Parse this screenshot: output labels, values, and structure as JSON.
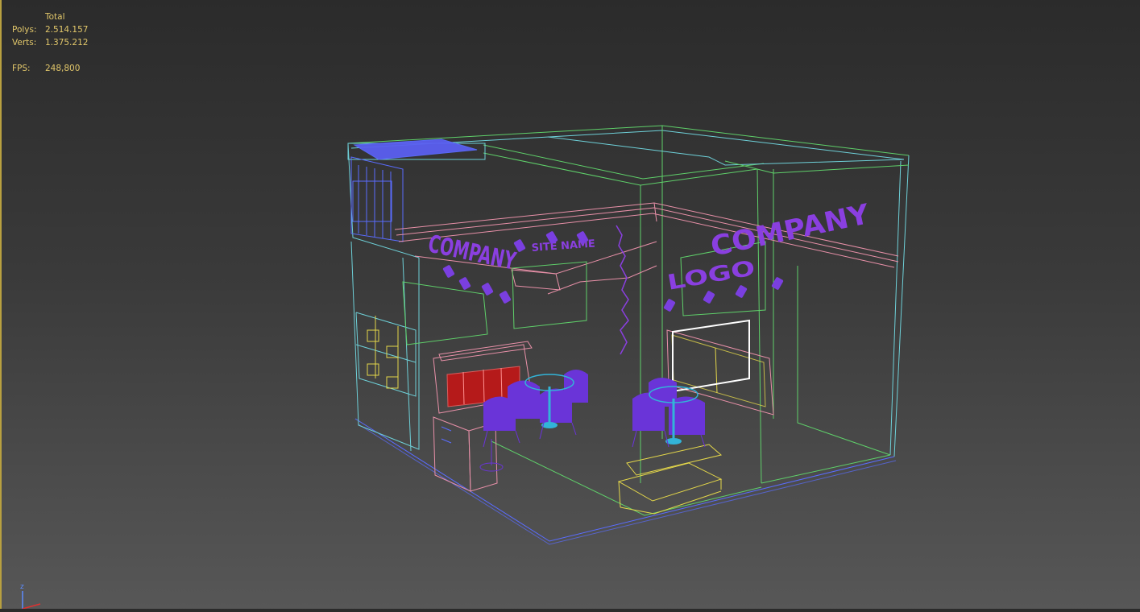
{
  "stats": {
    "header": "Total",
    "polys_label": "Polys:",
    "polys_value": "2.514.157",
    "verts_label": "Verts:",
    "verts_value": "1.375.212",
    "fps_label": "FPS:",
    "fps_value": "248,800"
  },
  "signage": {
    "left_sign": "COMPANY",
    "left_sub": "SITE NAME",
    "right_sign": "COMPANY",
    "right_sub": "LOGO"
  },
  "gizmo": {
    "z_label": "z"
  },
  "colors": {
    "background_top": "#2b2b2b",
    "background_bottom": "#575757",
    "stats_text": "#e2c76a",
    "wire_green": "#5fd06a",
    "wire_cyan": "#6ed0d8",
    "wire_blue": "#5a6cff",
    "wire_pink": "#e890a8",
    "wire_purple": "#8a3fe0",
    "wire_yellow": "#e4d74a",
    "selection_white": "#ffffff",
    "seat_red": "#c21616"
  }
}
